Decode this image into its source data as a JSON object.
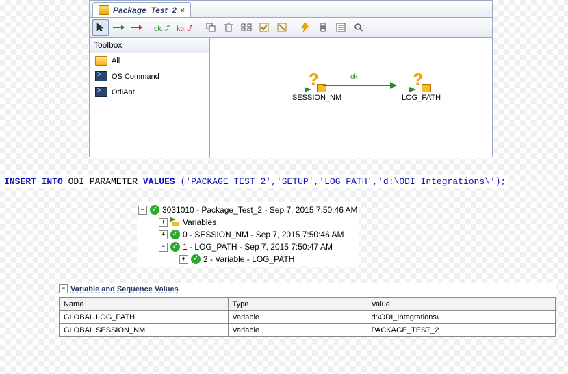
{
  "tab": {
    "title": "Package_Test_2",
    "close": "×"
  },
  "toolbox": {
    "title": "Toolbox",
    "items": [
      "All",
      "OS Command",
      "OdiAnt"
    ]
  },
  "canvas": {
    "node1": "SESSION_NM",
    "node2": "LOG_PATH",
    "edge_label": "ok"
  },
  "sql": {
    "kw1": "INSERT INTO",
    "table": " ODI_PARAMETER ",
    "kw2": "VALUES",
    "args": " ('PACKAGE_TEST_2','SETUP','LOG_PATH','d:\\ODI_Integrations\\');"
  },
  "tree": {
    "root": "3031010 - Package_Test_2 - Sep 7, 2015 7:50:46 AM",
    "vars": "Variables",
    "n0": "0 - SESSION_NM - Sep 7, 2015 7:50:46 AM",
    "n1": "1 - LOG_PATH - Sep 7, 2015 7:50:47 AM",
    "n2": "2 - Variable - LOG_PATH"
  },
  "section": {
    "title": "Variable and Sequence Values"
  },
  "table": {
    "headers": [
      "Name",
      "Type",
      "Value"
    ],
    "rows": [
      [
        "GLOBAL.LOG_PATH",
        "Variable",
        "d:\\ODI_Integrations\\"
      ],
      [
        "GLOBAL.SESSION_NM",
        "Variable",
        "PACKAGE_TEST_2"
      ]
    ]
  },
  "toolbar_icons": {
    "cursor": "cursor",
    "ok_arrow": "ok-arrow",
    "ko_arrow": "ko-arrow",
    "ok_label": "ok,",
    "ko_label": "ko,"
  }
}
